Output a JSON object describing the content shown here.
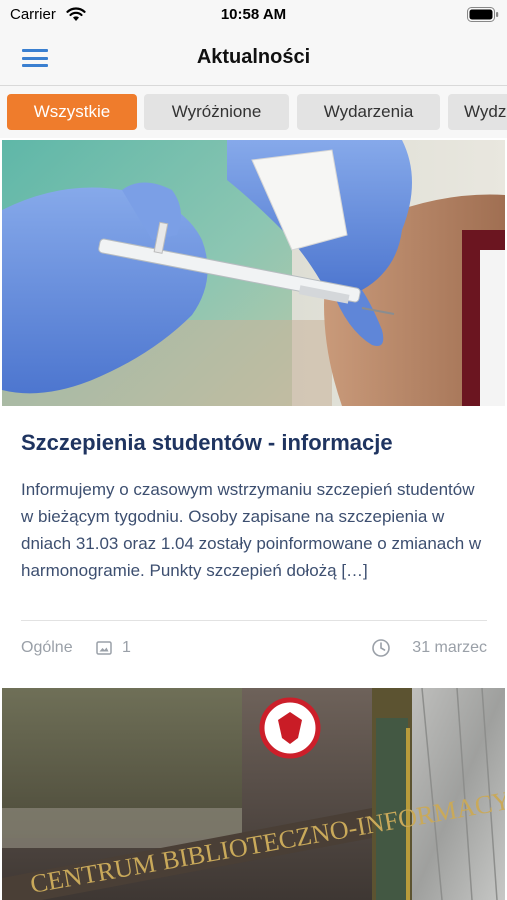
{
  "status_bar": {
    "carrier": "Carrier",
    "time": "10:58 AM"
  },
  "header": {
    "title": "Aktualności",
    "menu_icon": "hamburger-menu-icon"
  },
  "tabs": [
    {
      "label": "Wszystkie",
      "active": true
    },
    {
      "label": "Wyróżnione",
      "active": false
    },
    {
      "label": "Wydarzenia",
      "active": false
    },
    {
      "label": "Wydz",
      "active": false
    }
  ],
  "articles": [
    {
      "title": "Szczepienia studentów - informacje",
      "excerpt": "Informujemy o czasowym wstrzymaniu szczepień studentów w bieżącym tygodniu. Osoby zapisane na szczepienia w dniach 31.03 oraz 1.04 zostały poinformowane o zmianach w harmonogramie. Punkty szczepień dołożą […]",
      "category": "Ogólne",
      "image_count": "1",
      "date": "31 marzec"
    },
    {
      "sign_text": "CENTRUM BIBLIOTECZNO-INFORMACYJNE"
    }
  ],
  "colors": {
    "accent": "#ef7c2c",
    "menu": "#3a7fd0",
    "title": "#1f3460"
  }
}
